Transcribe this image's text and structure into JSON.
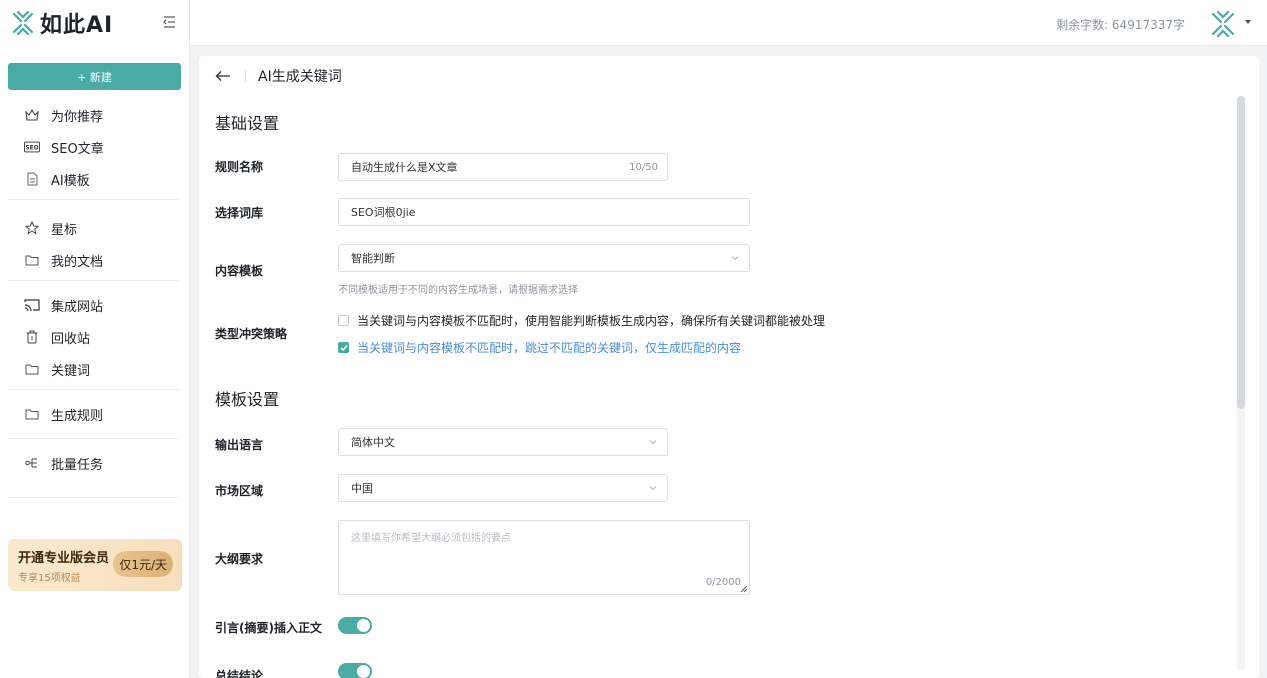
{
  "brand": {
    "name": "如此AI",
    "accent": "#4aaba5"
  },
  "sidebar": {
    "new_label": "+ 新建",
    "groups": [
      [
        {
          "label": "为你推荐",
          "icon": "crown-icon"
        },
        {
          "label": "SEO文章",
          "icon": "seo-badge-icon"
        },
        {
          "label": "AI模板",
          "icon": "document-icon"
        }
      ],
      [
        {
          "label": "星标",
          "icon": "star-icon"
        },
        {
          "label": "我的文档",
          "icon": "folder-icon"
        }
      ],
      [
        {
          "label": "集成网站",
          "icon": "cast-icon"
        },
        {
          "label": "回收站",
          "icon": "trash-icon"
        },
        {
          "label": "关键词",
          "icon": "folder-icon"
        }
      ],
      [
        {
          "label": "生成规则",
          "icon": "folder-icon"
        }
      ],
      [
        {
          "label": "批量任务",
          "icon": "flow-icon"
        }
      ]
    ],
    "promo": {
      "title": "开通专业版会员",
      "subtitle": "专享15项权益",
      "button": "仅1元/天"
    }
  },
  "header": {
    "quota": "剩余字数: 64917337字"
  },
  "page": {
    "title": "AI生成关键词",
    "section_basic": "基础设置",
    "rule_name": {
      "label": "规则名称",
      "value": "自动生成什么是X文章",
      "count": "10/50"
    },
    "lexicon": {
      "label": "选择词库",
      "value": "SEO词根0jie"
    },
    "content_template": {
      "label": "内容模板",
      "value": "智能判断",
      "hint": "不同模板适用于不同的内容生成场景，请根据需求选择"
    },
    "conflict": {
      "label": "类型冲突策略",
      "options": [
        {
          "text": "当关键词与内容模板不匹配时，使用智能判断模板生成内容，确保所有关键词都能被处理",
          "checked": false
        },
        {
          "text": "当关键词与内容模板不匹配时，跳过不匹配的关键词，仅生成匹配的内容",
          "checked": true
        }
      ]
    },
    "section_template": "模板设置",
    "language": {
      "label": "输出语言",
      "value": "简体中文"
    },
    "market": {
      "label": "市场区域",
      "value": "中国"
    },
    "outline": {
      "label": "大纲要求",
      "placeholder": "这里填写你希望大纲必须包括的要点",
      "count": "0/2000"
    },
    "quote_insert": {
      "label": "引言(摘要)插入正文",
      "on": true
    },
    "summary": {
      "label": "总结结论",
      "on": true
    }
  }
}
